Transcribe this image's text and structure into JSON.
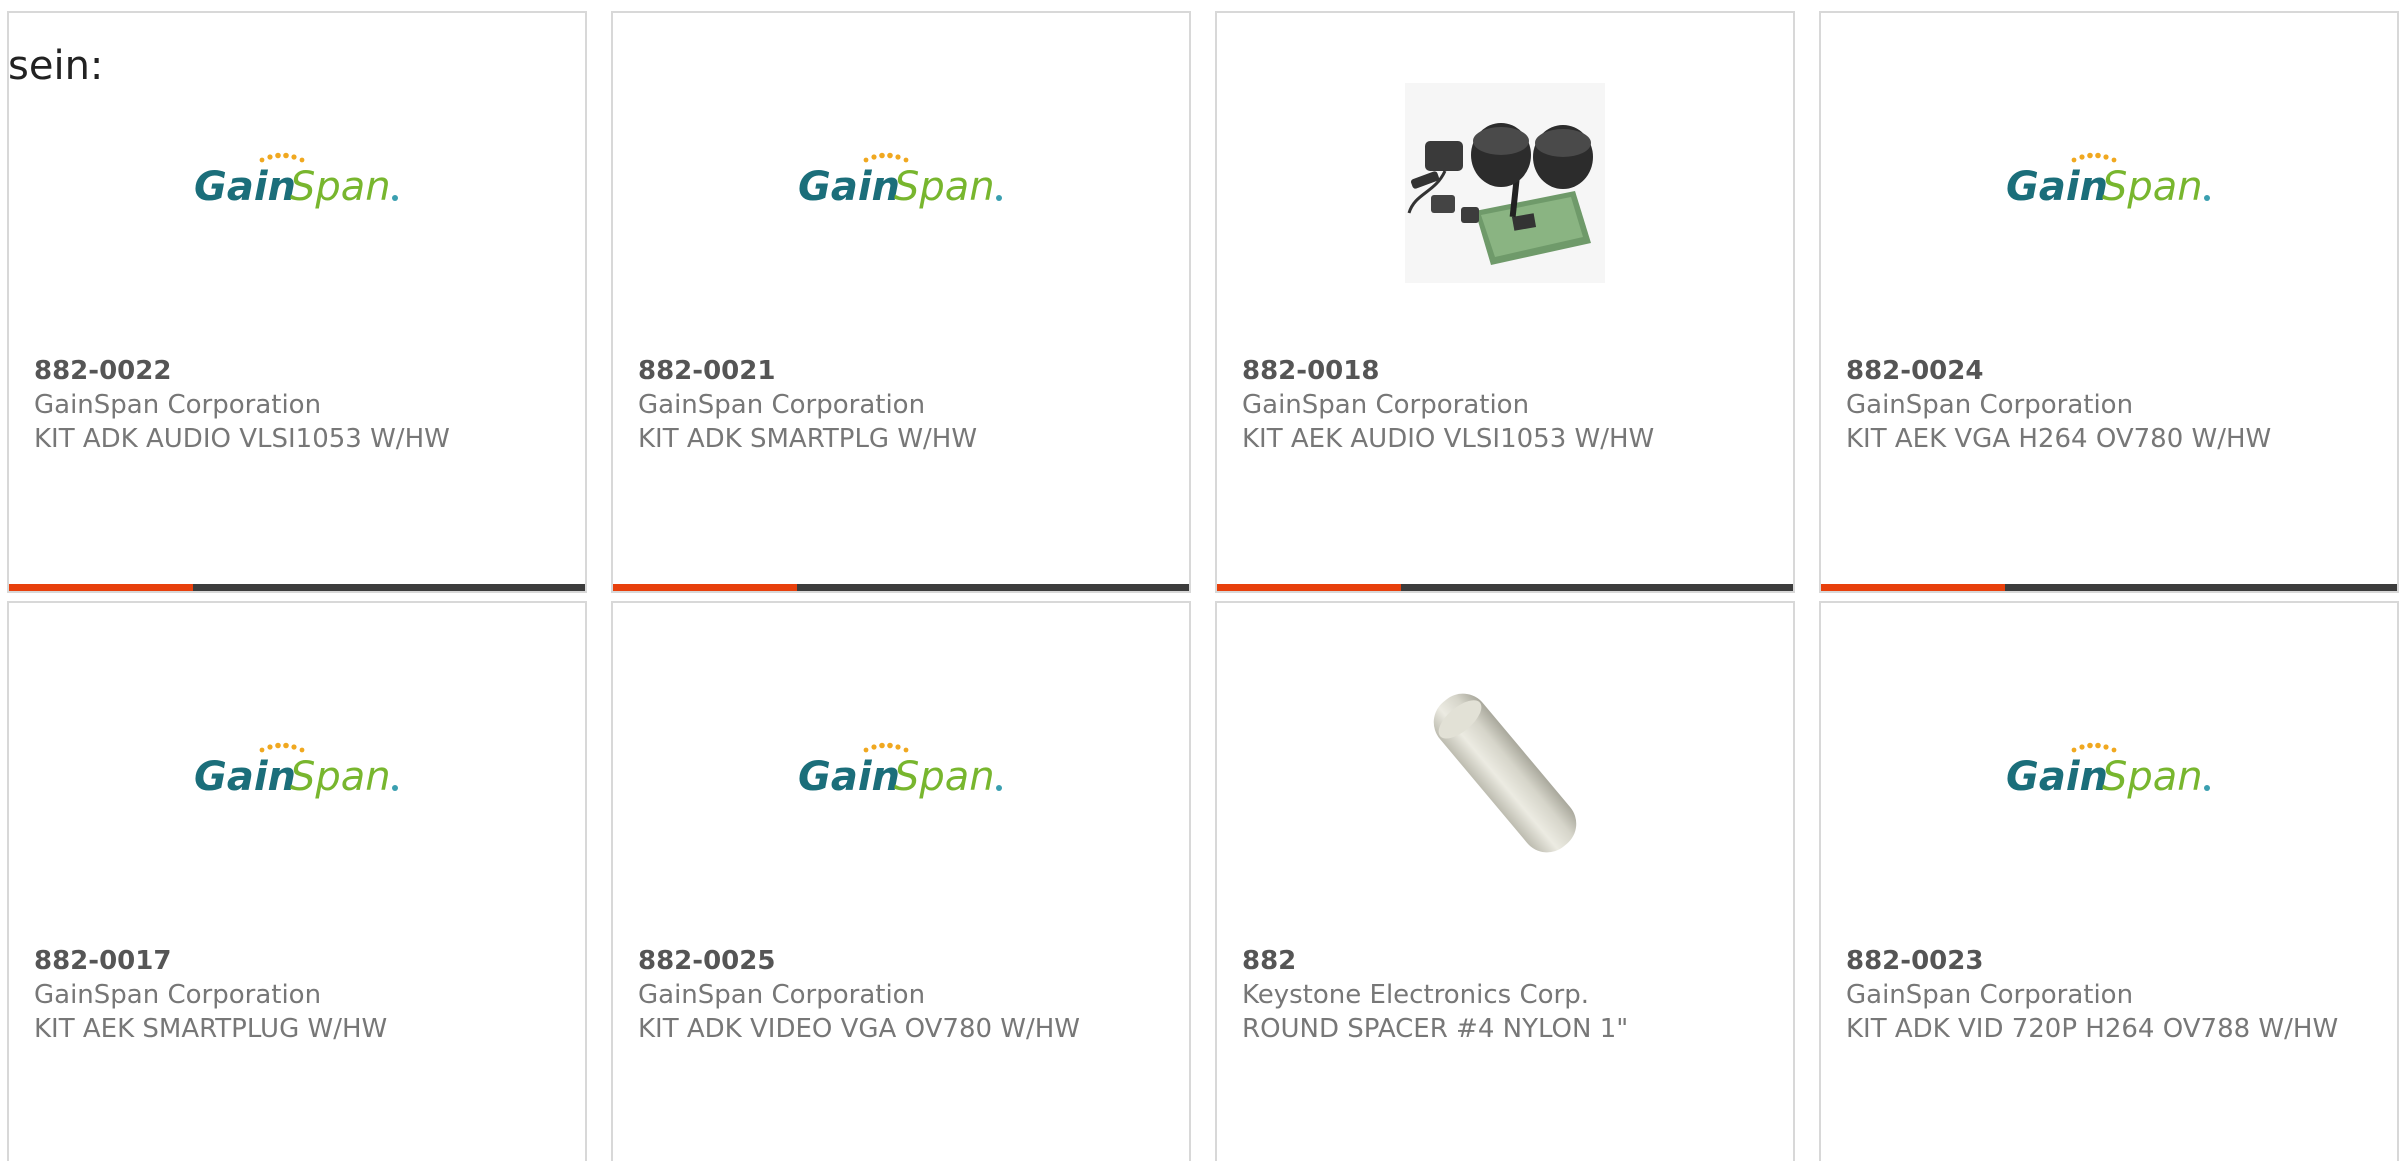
{
  "intro_text": "sein:",
  "colors": {
    "accent": "#e8400c",
    "bar_dark": "#3c3c3c",
    "logo_teal": "#1b6e7a",
    "logo_green": "#78b62e",
    "logo_dots": "#f0a820"
  },
  "logo": {
    "gain": "Gain",
    "span": "Span"
  },
  "products": [
    {
      "part": "882-0022",
      "maker": "GainSpan Corporation",
      "desc": "KIT ADK AUDIO VLSI1053 W/HW",
      "image": "gainspan-logo",
      "accent_fraction": 0.32
    },
    {
      "part": "882-0021",
      "maker": "GainSpan Corporation",
      "desc": "KIT ADK SMARTPLG W/HW",
      "image": "gainspan-logo",
      "accent_fraction": 0.32
    },
    {
      "part": "882-0018",
      "maker": "GainSpan Corporation",
      "desc": "KIT AEK AUDIO VLSI1053 W/HW",
      "image": "kit-photo",
      "accent_fraction": 0.32
    },
    {
      "part": "882-0024",
      "maker": "GainSpan Corporation",
      "desc": "KIT AEK VGA H264 OV780 W/HW",
      "image": "gainspan-logo",
      "accent_fraction": 0.32
    },
    {
      "part": "882-0017",
      "maker": "GainSpan Corporation",
      "desc": "KIT AEK SMARTPLUG W/HW",
      "image": "gainspan-logo",
      "accent_fraction": 0.32
    },
    {
      "part": "882-0025",
      "maker": "GainSpan Corporation",
      "desc": "KIT ADK VIDEO VGA OV780 W/HW",
      "image": "gainspan-logo",
      "accent_fraction": 0.32
    },
    {
      "part": "882",
      "maker": "Keystone Electronics Corp.",
      "desc": "ROUND SPACER #4 NYLON 1\"",
      "image": "spacer-photo",
      "accent_fraction": 0.32
    },
    {
      "part": "882-0023",
      "maker": "GainSpan Corporation",
      "desc": "KIT ADK VID 720P H264 OV788 W/HW",
      "image": "gainspan-logo",
      "accent_fraction": 0.32
    }
  ]
}
